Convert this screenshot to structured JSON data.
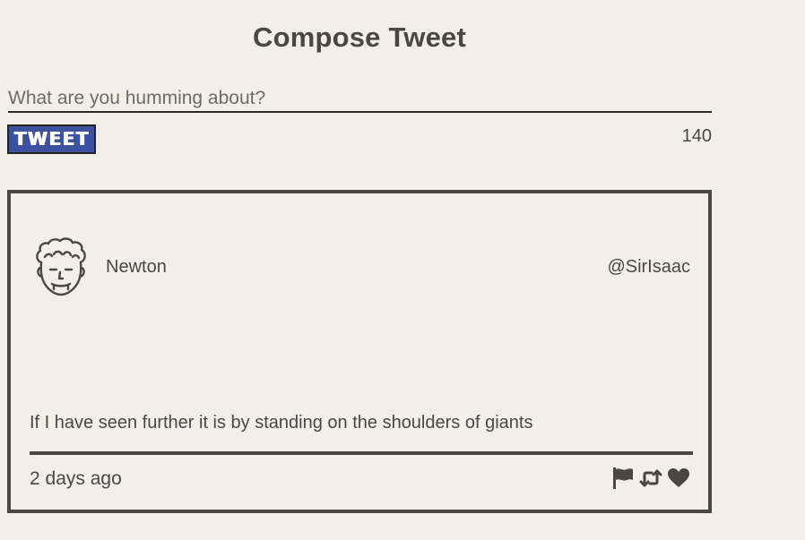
{
  "compose": {
    "title": "Compose Tweet",
    "placeholder": "What are you humming about?",
    "value": "",
    "button_label": "TWEET",
    "char_count": "140"
  },
  "tweet": {
    "author_name": "Newton",
    "handle": "@SirIsaac",
    "text": "If I have seen further it is by standing on the shoulders of giants",
    "timestamp": "2 days ago",
    "avatar_icon": "cartoon-face-icon",
    "actions": [
      {
        "icon": "flag-icon"
      },
      {
        "icon": "retweet-icon"
      },
      {
        "icon": "heart-icon"
      }
    ]
  },
  "colors": {
    "background": "#f2efe9",
    "text": "#4a4740",
    "button": "#3c52a0",
    "border": "#4a4740"
  }
}
